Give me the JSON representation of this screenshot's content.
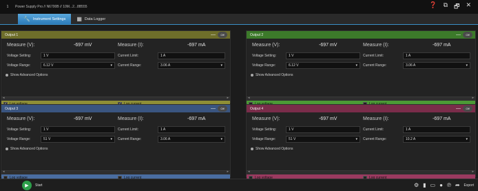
{
  "titlebar": {
    "app_num": "1",
    "title": "Power Supply Pro // N6700B // 10M...2...8B555"
  },
  "tabs": [
    {
      "label": "Instrument Settings",
      "icon": "wrench-icon"
    },
    {
      "label": "Data Logger",
      "icon": "grid-icon"
    }
  ],
  "panels": [
    {
      "name": "Output 1",
      "color": "#7a7a2e",
      "header_color": "#6e6e2a",
      "log_color": "#8f8f36",
      "measure_v_label": "Measure (V):",
      "measure_v": "-697 mV",
      "measure_i_label": "Measure (I):",
      "measure_i": "-697 mA",
      "voltage_setting_label": "Voltage Setting:",
      "voltage_setting": "1 V",
      "current_limit_label": "Current Limit:",
      "current_limit": "1 A",
      "voltage_range_label": "Voltage Range:",
      "voltage_range": "6.12 V",
      "current_range_label": "Current Range:",
      "current_range": "3.06 A",
      "advanced": "Show Advanced Options",
      "log_voltage": "Log voltage",
      "log_current": "Log current",
      "log_voltage_checked": true,
      "log_current_checked": true,
      "toggle": "Off"
    },
    {
      "name": "Output 2",
      "color": "#3e7a2c",
      "header_color": "#3c7a2a",
      "log_color": "#4c9a36",
      "measure_v_label": "Measure (V):",
      "measure_v": "-697 mV",
      "measure_i_label": "Measure (I):",
      "measure_i": "-697 mA",
      "voltage_setting_label": "Voltage Setting:",
      "voltage_setting": "1 V",
      "current_limit_label": "Current Limit:",
      "current_limit": "1 A",
      "voltage_range_label": "Voltage Range:",
      "voltage_range": "6.12 V",
      "current_range_label": "Current Range:",
      "current_range": "3.06 A",
      "advanced": "Show Advanced Options",
      "log_voltage": "Log voltage",
      "log_current": "Log current",
      "log_voltage_checked": false,
      "log_current_checked": false,
      "toggle": "Off"
    },
    {
      "name": "Output 3",
      "color": "#35507a",
      "header_color": "#3a5580",
      "log_color": "#4a6da0",
      "measure_v_label": "Measure (V):",
      "measure_v": "-697 mV",
      "measure_i_label": "Measure (I):",
      "measure_i": "-697 mA",
      "voltage_setting_label": "Voltage Setting:",
      "voltage_setting": "1 V",
      "current_limit_label": "Current Limit:",
      "current_limit": "1 A",
      "voltage_range_label": "Voltage Range:",
      "voltage_range": "51 V",
      "current_range_label": "Current Range:",
      "current_range": "3.06 A",
      "advanced": "Show Advanced Options",
      "log_voltage": "Log voltage",
      "log_current": "Log current",
      "log_voltage_checked": false,
      "log_current_checked": false,
      "toggle": "Off"
    },
    {
      "name": "Output 4",
      "color": "#7a2e4e",
      "header_color": "#7a2c4a",
      "log_color": "#9a3a60",
      "measure_v_label": "Measure (V):",
      "measure_v": "-697 mV",
      "measure_i_label": "Measure (I):",
      "measure_i": "-697 mA",
      "voltage_setting_label": "Voltage Setting:",
      "voltage_setting": "1 V",
      "current_limit_label": "Current Limit:",
      "current_limit": "1 A",
      "voltage_range_label": "Voltage Range:",
      "voltage_range": "51 V",
      "current_range_label": "Current Range:",
      "current_range": "10.2 A",
      "advanced": "Show Advanced Options",
      "log_voltage": "Log voltage",
      "log_current": "Log current",
      "log_voltage_checked": false,
      "log_current_checked": false,
      "toggle": "Off"
    }
  ],
  "bottombar": {
    "start_label": "Start",
    "export_label": "Export"
  }
}
